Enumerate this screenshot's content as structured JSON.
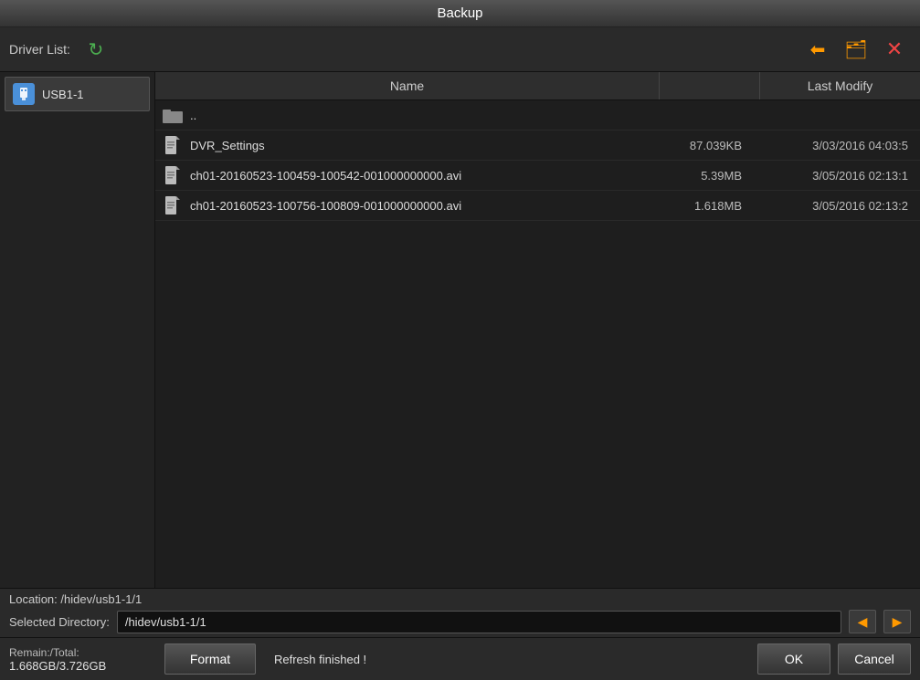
{
  "title": "Backup",
  "toolbar": {
    "driver_label": "Driver List:",
    "refresh_icon": "↻",
    "back_icon": "⬅",
    "newfolder_icon": "📁+",
    "close_icon": "✕"
  },
  "sidebar": {
    "usb_label": "USB1-1"
  },
  "file_table": {
    "col_name": "Name",
    "col_size": "",
    "col_date": "Last Modify",
    "rows": [
      {
        "type": "folder",
        "name": "..",
        "size": "",
        "date": ""
      },
      {
        "type": "file",
        "name": "DVR_Settings",
        "size": "87.039KB",
        "date": "3/03/2016 04:03:5"
      },
      {
        "type": "file",
        "name": "ch01-20160523-100459-100542-001000000000.avi",
        "size": "5.39MB",
        "date": "3/05/2016 02:13:1"
      },
      {
        "type": "file",
        "name": "ch01-20160523-100756-100809-001000000000.avi",
        "size": "1.618MB",
        "date": "3/05/2016 02:13:2"
      }
    ]
  },
  "bottom": {
    "location_label": "Location: /hidev/usb1-1/1",
    "selected_dir_label": "Selected Directory:",
    "selected_dir_value": "/hidev/usb1-1/1"
  },
  "footer": {
    "remain_label": "Remain:/Total:",
    "remain_value": "1.668GB/3.726GB",
    "status": "Refresh finished !",
    "format_btn": "Format",
    "ok_btn": "OK",
    "cancel_btn": "Cancel"
  }
}
